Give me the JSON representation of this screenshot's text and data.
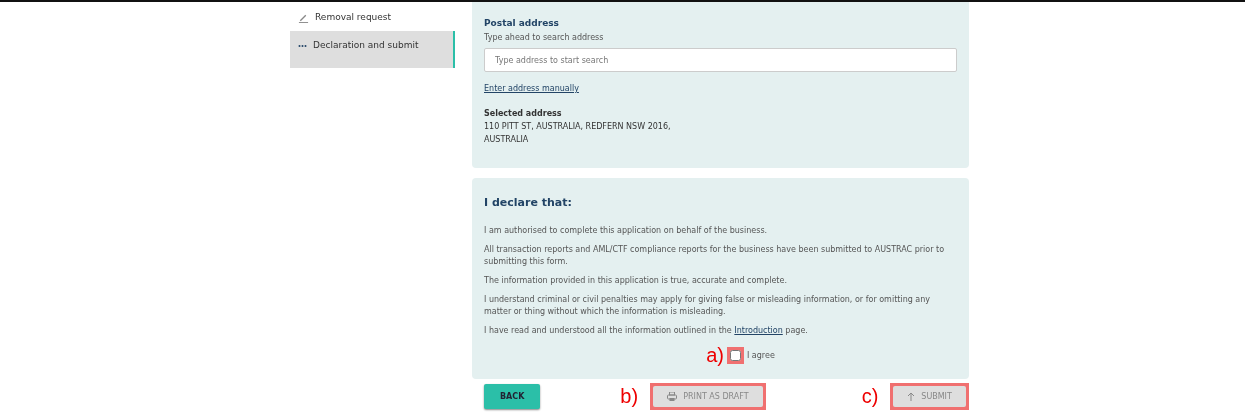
{
  "sidebar": {
    "items": [
      {
        "label": "Removal request",
        "kind": "edit",
        "selected": false
      },
      {
        "label": "Declaration and submit",
        "kind": "current",
        "selected": true
      }
    ]
  },
  "postal_address": {
    "heading": "Postal address",
    "hint": "Type ahead to search address",
    "search": {
      "placeholder": "Type address to start search"
    },
    "manual_link": "Enter address manually",
    "selected_label": "Selected address",
    "selected_lines": [
      "110 PITT ST, AUSTRALIA, REDFERN NSW 2016,",
      "AUSTRALIA"
    ]
  },
  "declaration": {
    "heading": "I declare that:",
    "statements": [
      "I am authorised to complete this application on behalf of the business.",
      "All transaction reports and AML/CTF compliance reports for the business have been submitted to AUSTRAC prior to submitting this form.",
      "The information provided in this application is true, accurate and complete.",
      "I understand criminal or civil penalties may apply for giving false or misleading information, or for omitting any matter or thing without which the information is misleading.",
      {
        "before": "I have read and understood all the information outlined in the ",
        "link": "Introduction",
        "after": " page."
      }
    ],
    "agree": {
      "label": "I agree",
      "checked": false,
      "annotation": "a)"
    }
  },
  "buttons": [
    {
      "label": "BACK",
      "kind": "primary",
      "disabled": false
    },
    {
      "label": "PRINT AS DRAFT",
      "kind": "print",
      "disabled": true,
      "annotation": "b)"
    },
    {
      "label": "SUBMIT",
      "kind": "submit",
      "disabled": true,
      "annotation": "c)"
    }
  ]
}
